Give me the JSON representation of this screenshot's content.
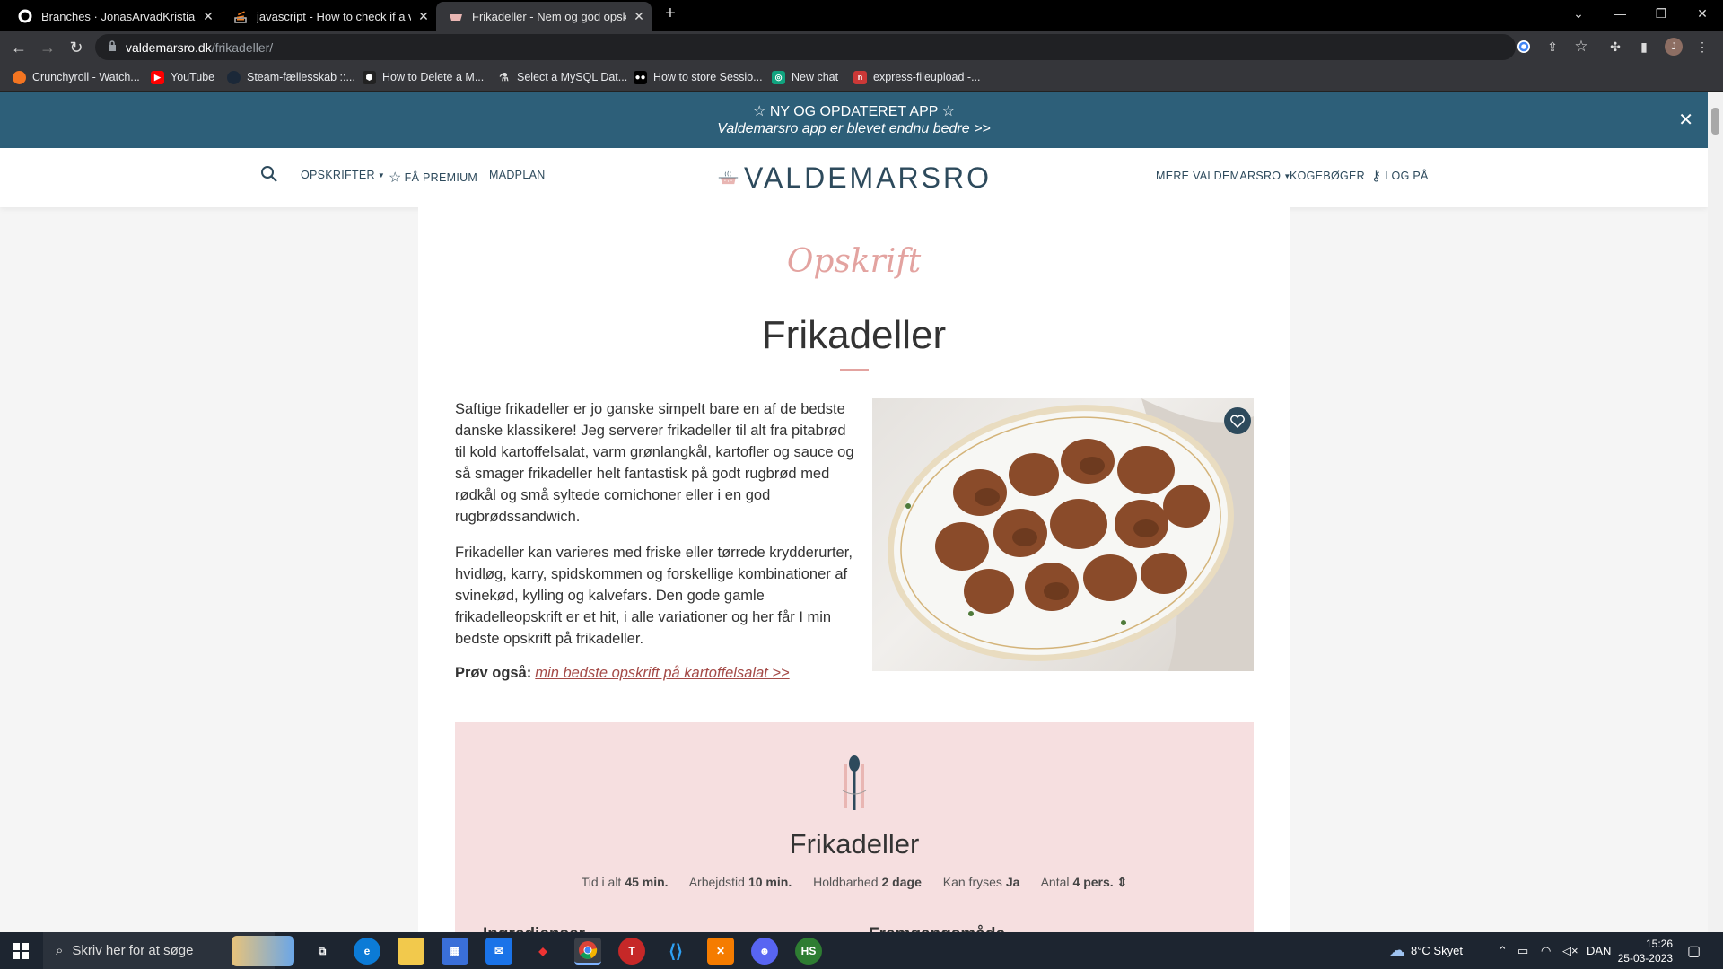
{
  "browser": {
    "tabs": [
      {
        "title": "Branches · JonasArvadKristiansen",
        "icon": "github-icon"
      },
      {
        "title": "javascript - How to check if a var",
        "icon": "stackoverflow-icon"
      },
      {
        "title": "Frikadeller - Nem og god opskrift",
        "icon": "valdemarsro-icon",
        "active": true
      }
    ],
    "new_tab": "+",
    "url_domain": "valdemarsro.dk",
    "url_path": "/frikadeller/",
    "profile_initial": "J",
    "bookmarks": [
      {
        "label": "Crunchyroll - Watch...",
        "icon": "crunchyroll-icon",
        "color": "#f47521"
      },
      {
        "label": "YouTube",
        "icon": "youtube-icon",
        "color": "#ff0000"
      },
      {
        "label": "Steam-fællesskab ::...",
        "icon": "steam-icon",
        "color": "#1b2838"
      },
      {
        "label": "How to Delete a M...",
        "icon": "hexagon-icon",
        "color": "#222222"
      },
      {
        "label": "Select a MySQL Dat...",
        "icon": "flask-icon",
        "color": "#555555"
      },
      {
        "label": "How to store Sessio...",
        "icon": "medium-icon",
        "color": "#000000"
      },
      {
        "label": "New chat",
        "icon": "openai-icon",
        "color": "#10a37f"
      },
      {
        "label": "express-fileupload -...",
        "icon": "npm-icon",
        "color": "#cb3837"
      }
    ]
  },
  "promo": {
    "line1": "☆ NY OG OPDATERET APP ☆",
    "line2": "Valdemarsro app er blevet endnu bedre >>",
    "close": "✕"
  },
  "nav": {
    "recipes": "OPSKRIFTER",
    "premium": "FÅ PREMIUM",
    "mealplan": "MADPLAN",
    "logo": "VALDEMARSRO",
    "more": "MERE VALDEMARSRO",
    "cookbooks": "KOGEBØGER",
    "login": "LOG PÅ"
  },
  "article": {
    "kicker": "Opskrift",
    "title": "Frikadeller",
    "para1": "Saftige frikadeller er jo ganske simpelt bare en af de bedste danske klassikere! Jeg serverer frikadeller til alt fra pitabrød til kold kartoffelsalat, varm grønlangkål, kartofler og sauce og så smager frikadeller helt fantastisk på godt rugbrød med rødkål og små syltede cornichoner eller i en god rugbrødssandwich.",
    "para2": "Frikadeller kan varieres med friske eller tørrede krydderurter, hvidløg, karry, spidskommen og forskellige kombinationer af svinekød, kylling og kalvefars. Den gode gamle frikadelleopskrift er et hit, i alle variationer og her får I min bedste opskrift på frikadeller.",
    "try_label": "Prøv også:",
    "try_link": "min bedste opskrift på kartoffelsalat >>"
  },
  "recipe": {
    "title": "Frikadeller",
    "meta": [
      {
        "label": "Tid i alt",
        "value": "45 min."
      },
      {
        "label": "Arbejdstid",
        "value": "10 min."
      },
      {
        "label": "Holdbarhed",
        "value": "2 dage"
      },
      {
        "label": "Kan fryses",
        "value": "Ja"
      },
      {
        "label": "Antal",
        "value": "4 pers. ⇕"
      }
    ],
    "ingredients_heading": "Ingredienser",
    "method_heading": "Fremgangsmåde"
  },
  "taskbar": {
    "search_placeholder": "Skriv her for at søge",
    "weather": "8°C  Skyet",
    "language": "DAN",
    "time": "15:26",
    "date": "25-03-2023"
  }
}
